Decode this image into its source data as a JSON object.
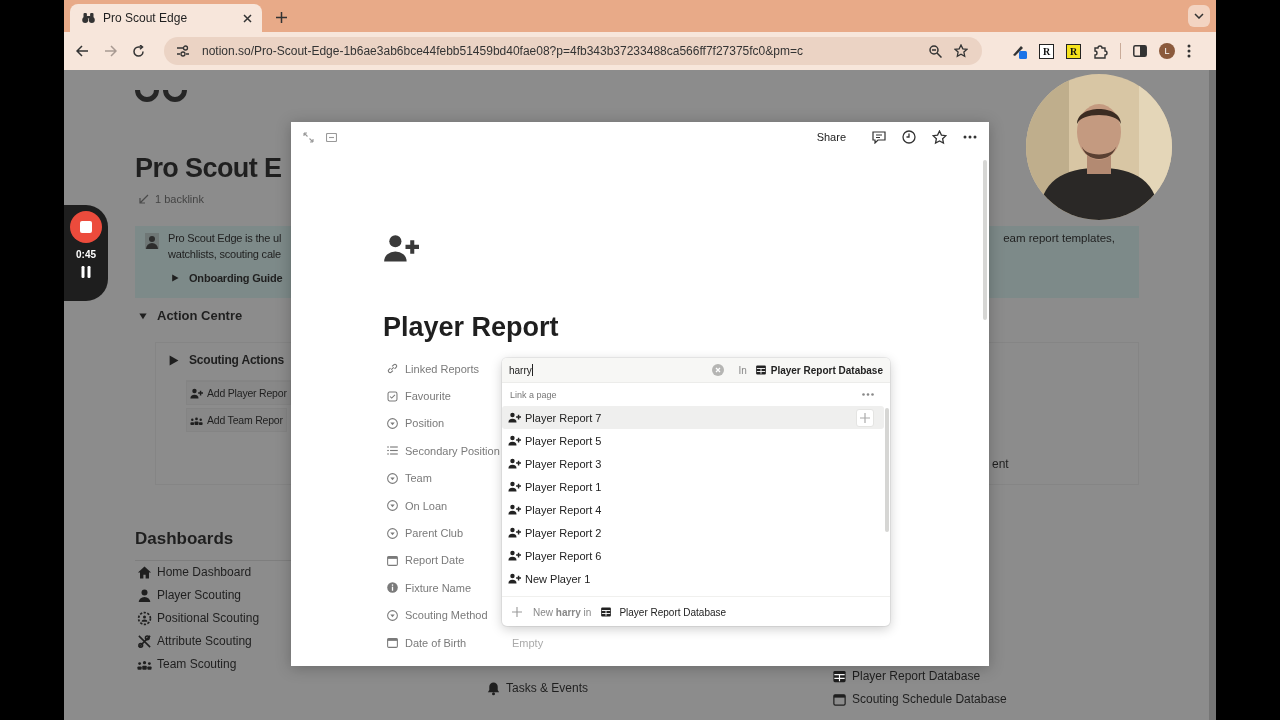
{
  "browser": {
    "tabs": [
      {
        "title": "Pro Scout Edge",
        "selected": true
      }
    ],
    "forward": {
      "disabled": true
    },
    "url": "notion.so/Pro-Scout-Edge-1b6ae3ab6bce44febb51459bd40fae08?p=4fb343b37233488ca566ff7f27375fc0&pm=c",
    "extensions": [
      {
        "kind": "pen"
      },
      {
        "kind": "letter",
        "label": "R",
        "color": "#ffffff"
      },
      {
        "kind": "letter",
        "label": "R",
        "color": "#f5e21c"
      },
      {
        "kind": "puzzle"
      }
    ],
    "profile": "L"
  },
  "recorder": {
    "time": "0:45"
  },
  "page": {
    "title": "Pro Scout E",
    "backlinks": "1 backlink",
    "callout": {
      "lines": [
        "Pro Scout Edge is the ul",
        "watchlists, scouting cale"
      ],
      "right_text": "eam report templates,",
      "toggle": {
        "label": "Onboarding Guide",
        "expanded": false
      }
    },
    "action_centre": {
      "label": "Action Centre",
      "expanded": true,
      "section": {
        "label": "Scouting Actions",
        "expanded": false
      },
      "buttons": [
        {
          "label": "Add Player Repor",
          "kind": "person-plus"
        },
        {
          "label": "Add Team Repor",
          "kind": "team"
        }
      ],
      "right_fragment": "ent"
    },
    "dashboards": {
      "title": "Dashboards",
      "items": [
        {
          "label": "Home Dashboard",
          "kind": "home"
        },
        {
          "label": "Player Scouting",
          "kind": "person"
        },
        {
          "label": "Positional Scouting",
          "kind": "positional"
        },
        {
          "label": "Attribute Scouting",
          "kind": "attribute"
        },
        {
          "label": "Team Scouting",
          "kind": "team"
        }
      ]
    },
    "middle_links": [
      {
        "label": "Tasks & Events",
        "kind": "bell"
      }
    ],
    "databases": [
      {
        "label": "Player Report Database",
        "kind": "table"
      },
      {
        "label": "Scouting Schedule Database",
        "kind": "calendar"
      }
    ]
  },
  "modal": {
    "share": "Share",
    "title": "Player Report",
    "properties": [
      {
        "label": "Linked Reports",
        "kind": "link"
      },
      {
        "label": "Favourite",
        "kind": "checkbox"
      },
      {
        "label": "Position",
        "kind": "select"
      },
      {
        "label": "Secondary Position",
        "kind": "list"
      },
      {
        "label": "Team",
        "kind": "select"
      },
      {
        "label": "On Loan",
        "kind": "select"
      },
      {
        "label": "Parent Club",
        "kind": "select"
      },
      {
        "label": "Report Date",
        "kind": "calendar"
      },
      {
        "label": "Fixture Name",
        "kind": "info"
      },
      {
        "label": "Scouting Method",
        "kind": "select"
      },
      {
        "label": "Date of Birth",
        "kind": "calendar",
        "value": "Empty"
      }
    ]
  },
  "link_popup": {
    "query": "harry",
    "scope_prefix": "In",
    "scope": "Player Report Database",
    "heading": "Link a page",
    "results": [
      {
        "title": "Player Report 7",
        "selected": true
      },
      {
        "title": "Player Report 5",
        "selected": false
      },
      {
        "title": "Player Report 3",
        "selected": false
      },
      {
        "title": "Player Report 1",
        "selected": false
      },
      {
        "title": "Player Report 4",
        "selected": false
      },
      {
        "title": "Player Report 2",
        "selected": false
      },
      {
        "title": "Player Report 6",
        "selected": false
      },
      {
        "title": "New Player 1",
        "selected": false
      }
    ],
    "create": "New **harry** in",
    "create_target": "Player Report Database"
  }
}
